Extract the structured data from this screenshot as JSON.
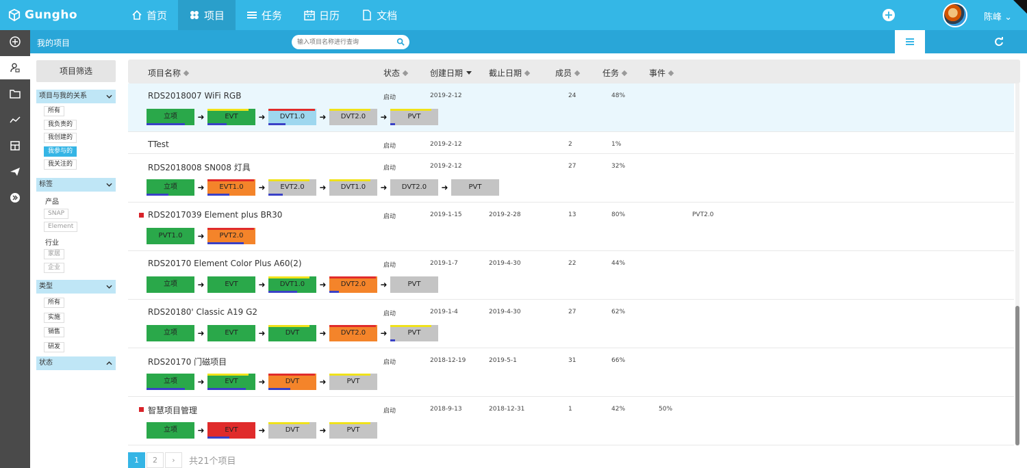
{
  "app": {
    "brand": "Gungho"
  },
  "nav": [
    {
      "label": "首页",
      "icon": "home-icon"
    },
    {
      "label": "项目",
      "icon": "grid-icon",
      "active": true
    },
    {
      "label": "任务",
      "icon": "list-icon"
    },
    {
      "label": "日历",
      "icon": "calendar-icon"
    },
    {
      "label": "文档",
      "icon": "document-icon"
    }
  ],
  "user": {
    "name": "陈峰 ⌄"
  },
  "subbar": {
    "title": "我的项目",
    "search_placeholder": "输入项目名称进行查询"
  },
  "filter": {
    "title": "项目筛选",
    "relation": {
      "label": "项目与我的关系",
      "options": [
        "所有",
        "我负责的",
        "我创建的",
        "我参与的",
        "我关注的"
      ],
      "selected": "我参与的"
    },
    "tags": {
      "label": "标签",
      "groups": [
        {
          "name": "产品",
          "options": [
            "SNAP",
            "Element"
          ]
        },
        {
          "name": "行业",
          "options": [
            "家居",
            "企业"
          ]
        }
      ]
    },
    "type": {
      "label": "类型",
      "options": [
        "所有",
        "实施",
        "销售",
        "研发"
      ]
    },
    "status": {
      "label": "状态"
    }
  },
  "table": {
    "headers": [
      "项目名称",
      "状态",
      "创建日期",
      "截止日期",
      "成员",
      "任务",
      "事件"
    ]
  },
  "projects": [
    {
      "name": "RDS2018007  WiFi RGB",
      "flag": false,
      "status": "启动",
      "created": "2019-2-12",
      "due": "",
      "members": "24",
      "tasks": "48%",
      "events": "",
      "extra": "",
      "stages": [
        {
          "label": "立项",
          "color": "green",
          "top": null,
          "bottom": 0.8
        },
        {
          "label": "EVT",
          "color": "green",
          "top": "yellow",
          "bottom": 0.4
        },
        {
          "label": "DVT1.0",
          "color": "lightblue",
          "top": "red",
          "bottom": 0.35
        },
        {
          "label": "DVT2.0",
          "color": "gray",
          "top": "yellow",
          "bottom": 0
        },
        {
          "label": "PVT",
          "color": "gray",
          "top": "yellow",
          "bottom": 0.1
        }
      ]
    },
    {
      "name": "TTest",
      "flag": false,
      "status": "启动",
      "created": "2019-2-12",
      "due": "",
      "members": "2",
      "tasks": "1%",
      "events": "",
      "extra": "",
      "stages": []
    },
    {
      "name": "RDS2018008  SN008  灯具",
      "flag": false,
      "status": "启动",
      "created": "2019-2-12",
      "due": "",
      "members": "27",
      "tasks": "32%",
      "events": "",
      "extra": "",
      "stages": [
        {
          "label": "立项",
          "color": "green",
          "top": null,
          "bottom": 0.45
        },
        {
          "label": "EVT1.0",
          "color": "orange",
          "top": "red",
          "bottom": 0.45
        },
        {
          "label": "EVT2.0",
          "color": "gray",
          "top": "yellow",
          "bottom": 0.3
        },
        {
          "label": "DVT1.0",
          "color": "gray",
          "top": "yellow",
          "bottom": 0
        },
        {
          "label": "DVT2.0",
          "color": "gray",
          "top": null,
          "bottom": 0
        },
        {
          "label": "PVT",
          "color": "gray",
          "top": null,
          "bottom": 0
        }
      ]
    },
    {
      "name": "RDS2017039  Element plus BR30",
      "flag": true,
      "status": "启动",
      "created": "2019-1-15",
      "due": "2019-2-28",
      "members": "13",
      "tasks": "80%",
      "events": "",
      "extra": "PVT2.0",
      "stages": [
        {
          "label": "PVT1.0",
          "color": "green",
          "top": null,
          "bottom": 0
        },
        {
          "label": "PVT2.0",
          "color": "orange",
          "top": "red",
          "bottom": 0.75
        }
      ]
    },
    {
      "name": "RDS20170 Element Color Plus A60(2)",
      "flag": false,
      "status": "启动",
      "created": "2019-1-7",
      "due": "2019-4-30",
      "members": "22",
      "tasks": "44%",
      "events": "",
      "extra": "",
      "stages": [
        {
          "label": "立项",
          "color": "green",
          "top": null,
          "bottom": 0
        },
        {
          "label": "EVT",
          "color": "green",
          "top": null,
          "bottom": 0
        },
        {
          "label": "DVT1.0",
          "color": "green",
          "top": "yellow",
          "bottom": 0.6
        },
        {
          "label": "DVT2.0",
          "color": "orange",
          "top": "red",
          "bottom": 0.2
        },
        {
          "label": "PVT",
          "color": "gray",
          "top": null,
          "bottom": 0
        }
      ]
    },
    {
      "name": "RDS20180' Classic A19 G2",
      "flag": false,
      "status": "启动",
      "created": "2019-1-4",
      "due": "2019-4-30",
      "members": "27",
      "tasks": "62%",
      "events": "",
      "extra": "",
      "stages": [
        {
          "label": "立项",
          "color": "green",
          "top": null,
          "bottom": 0
        },
        {
          "label": "EVT",
          "color": "green",
          "top": null,
          "bottom": 0
        },
        {
          "label": "DVT",
          "color": "green",
          "top": "yellow",
          "bottom": 0
        },
        {
          "label": "DVT2.0",
          "color": "orange",
          "top": "red",
          "bottom": 0
        },
        {
          "label": "PVT",
          "color": "gray",
          "top": "yellow",
          "bottom": 0.1
        }
      ]
    },
    {
      "name": "RDS20170     门磁项目",
      "flag": false,
      "status": "启动",
      "created": "2018-12-19",
      "due": "2019-5-1",
      "members": "31",
      "tasks": "66%",
      "events": "",
      "extra": "",
      "stages": [
        {
          "label": "立项",
          "color": "green",
          "top": null,
          "bottom": 0.8
        },
        {
          "label": "EVT",
          "color": "green",
          "top": "yellow",
          "bottom": 0.8
        },
        {
          "label": "DVT",
          "color": "orange",
          "top": "red",
          "bottom": 0.45
        },
        {
          "label": "PVT",
          "color": "gray",
          "top": "yellow",
          "bottom": 0
        }
      ]
    },
    {
      "name": "智慧项目管理",
      "flag": true,
      "status": "启动",
      "created": "2018-9-13",
      "due": "2018-12-31",
      "members": "1",
      "tasks": "42%",
      "events": "50%",
      "extra": "",
      "stages": [
        {
          "label": "立项",
          "color": "green",
          "top": null,
          "bottom": 0
        },
        {
          "label": "EVT",
          "color": "red",
          "top": null,
          "bottom": 0.45
        },
        {
          "label": "DVT",
          "color": "gray",
          "top": "yellow",
          "bottom": 0
        },
        {
          "label": "PVT",
          "color": "gray",
          "top": "yellow",
          "bottom": 0
        }
      ]
    }
  ],
  "pagination": {
    "pages": [
      "1",
      "2",
      "›"
    ],
    "current": "1",
    "total": "共21个项目"
  },
  "colors": {
    "green": "#2aa84a",
    "orange": "#f4842a",
    "red": "#e02b2b",
    "lightblue": "#9ed7ef",
    "gray": "#c4c4c4",
    "yellow": "#f0e21a",
    "progress": "#3a41c6"
  }
}
